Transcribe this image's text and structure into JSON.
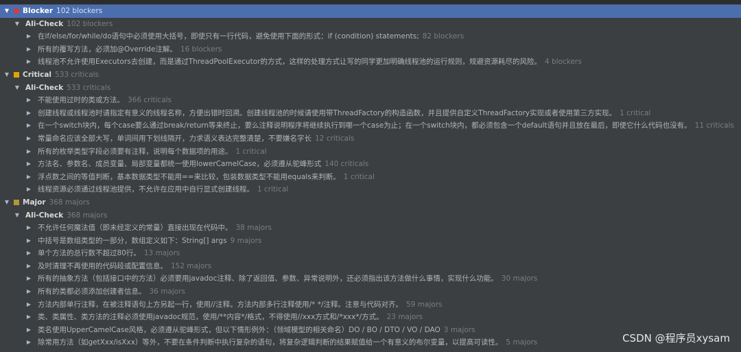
{
  "tree": [
    {
      "level": 0,
      "kind": "severity",
      "icon": "blocker-icon",
      "label": "Blocker",
      "count": "102 blockers",
      "selected": true
    },
    {
      "level": 1,
      "kind": "group",
      "label": "Ali-Check",
      "count": "102 blockers"
    },
    {
      "level": 2,
      "kind": "rule",
      "label": "在if/else/for/while/do语句中必须使用大括号，即使只有一行代码，避免使用下面的形式：if (condition) statements;",
      "count": "82 blockers"
    },
    {
      "level": 2,
      "kind": "rule",
      "label": "所有的覆写方法，必须加@Override注解。",
      "count": "16 blockers"
    },
    {
      "level": 2,
      "kind": "rule",
      "label": "线程池不允许使用Executors去创建，而是通过ThreadPoolExecutor的方式，这样的处理方式让写的同学更加明确线程池的运行规则，规避资源耗尽的风险。",
      "count": "4 blockers"
    },
    {
      "level": 0,
      "kind": "severity",
      "icon": "critical-icon",
      "label": "Critical",
      "count": "533 criticals"
    },
    {
      "level": 1,
      "kind": "group",
      "label": "Ali-Check",
      "count": "533 criticals"
    },
    {
      "level": 2,
      "kind": "rule",
      "label": "不能使用过时的类或方法。",
      "count": "366 criticals"
    },
    {
      "level": 2,
      "kind": "rule",
      "label": "创建线程或线程池时请指定有意义的线程名称，方便出错时回溯。创建线程池的时候请使用带ThreadFactory的构造函数，并且提供自定义ThreadFactory实现或者使用第三方实现。",
      "count": "1 critical"
    },
    {
      "level": 2,
      "kind": "rule",
      "label": "在一个switch块内，每个case要么通过break/return等来终止，要么注释说明程序将继续执行到哪一个case为止；在一个switch块内，都必须包含一个default语句并且放在最后，即使它什么代码也没有。",
      "count": "11 criticals"
    },
    {
      "level": 2,
      "kind": "rule",
      "label": "常量命名应该全部大写，单词间用下划线隔开，力求语义表达完整清楚，不要嫌名字长",
      "count": "12 criticals"
    },
    {
      "level": 2,
      "kind": "rule",
      "label": "所有的枚举类型字段必须要有注释，说明每个数据项的用途。",
      "count": "1 critical"
    },
    {
      "level": 2,
      "kind": "rule",
      "label": "方法名、参数名、成员变量、局部变量都统一使用lowerCamelCase，必须遵从驼峰形式",
      "count": "140 criticals"
    },
    {
      "level": 2,
      "kind": "rule",
      "label": "浮点数之间的等值判断，基本数据类型不能用==来比较，包装数据类型不能用equals来判断。",
      "count": "1 critical"
    },
    {
      "level": 2,
      "kind": "rule",
      "label": "线程资源必须通过线程池提供，不允许在应用中自行显式创建线程。",
      "count": "1 critical"
    },
    {
      "level": 0,
      "kind": "severity",
      "icon": "major-icon",
      "label": "Major",
      "count": "368 majors"
    },
    {
      "level": 1,
      "kind": "group",
      "label": "Ali-Check",
      "count": "368 majors"
    },
    {
      "level": 2,
      "kind": "rule",
      "label": "不允许任何魔法值（即未经定义的常量）直接出现在代码中。",
      "count": "38 majors"
    },
    {
      "level": 2,
      "kind": "rule",
      "label": "中括号是数组类型的一部分，数组定义如下：String[] args",
      "count": "9 majors"
    },
    {
      "level": 2,
      "kind": "rule",
      "label": "单个方法的总行数不超过80行。",
      "count": "13 majors"
    },
    {
      "level": 2,
      "kind": "rule",
      "label": "及时清理不再使用的代码段或配置信息。",
      "count": "152 majors"
    },
    {
      "level": 2,
      "kind": "rule",
      "label": "所有的抽象方法（包括接口中的方法）必须要用javadoc注释、除了返回值、参数、异常说明外，还必须指出该方法做什么事情，实现什么功能。",
      "count": "30 majors"
    },
    {
      "level": 2,
      "kind": "rule",
      "label": "所有的类都必须添加创建者信息。",
      "count": "36 majors"
    },
    {
      "level": 2,
      "kind": "rule",
      "label": "方法内部单行注释，在被注释语句上方另起一行，使用//注释。方法内部多行注释使用/* */注释。注意与代码对齐。",
      "count": "59 majors"
    },
    {
      "level": 2,
      "kind": "rule",
      "label": "类、类属性、类方法的注释必须使用javadoc规范，使用/**内容*/格式，不得使用//xxx方式和/*xxx*/方式。",
      "count": "23 majors"
    },
    {
      "level": 2,
      "kind": "rule",
      "label": "类名使用UpperCamelCase风格，必须遵从驼峰形式，但以下情形例外：（领域模型的相关命名）DO / BO / DTO / VO / DAO",
      "count": "3 majors"
    },
    {
      "level": 2,
      "kind": "rule",
      "label": "除常用方法（如getXxx/isXxx）等外，不要在条件判断中执行复杂的语句，将复杂逻辑判断的结果赋值给一个有意义的布尔变量，以提高可读性。",
      "count": "5 majors"
    }
  ],
  "watermark": "CSDN @程序员xysam",
  "glyphs": {
    "expanded": "▼",
    "collapsed": "▶"
  }
}
